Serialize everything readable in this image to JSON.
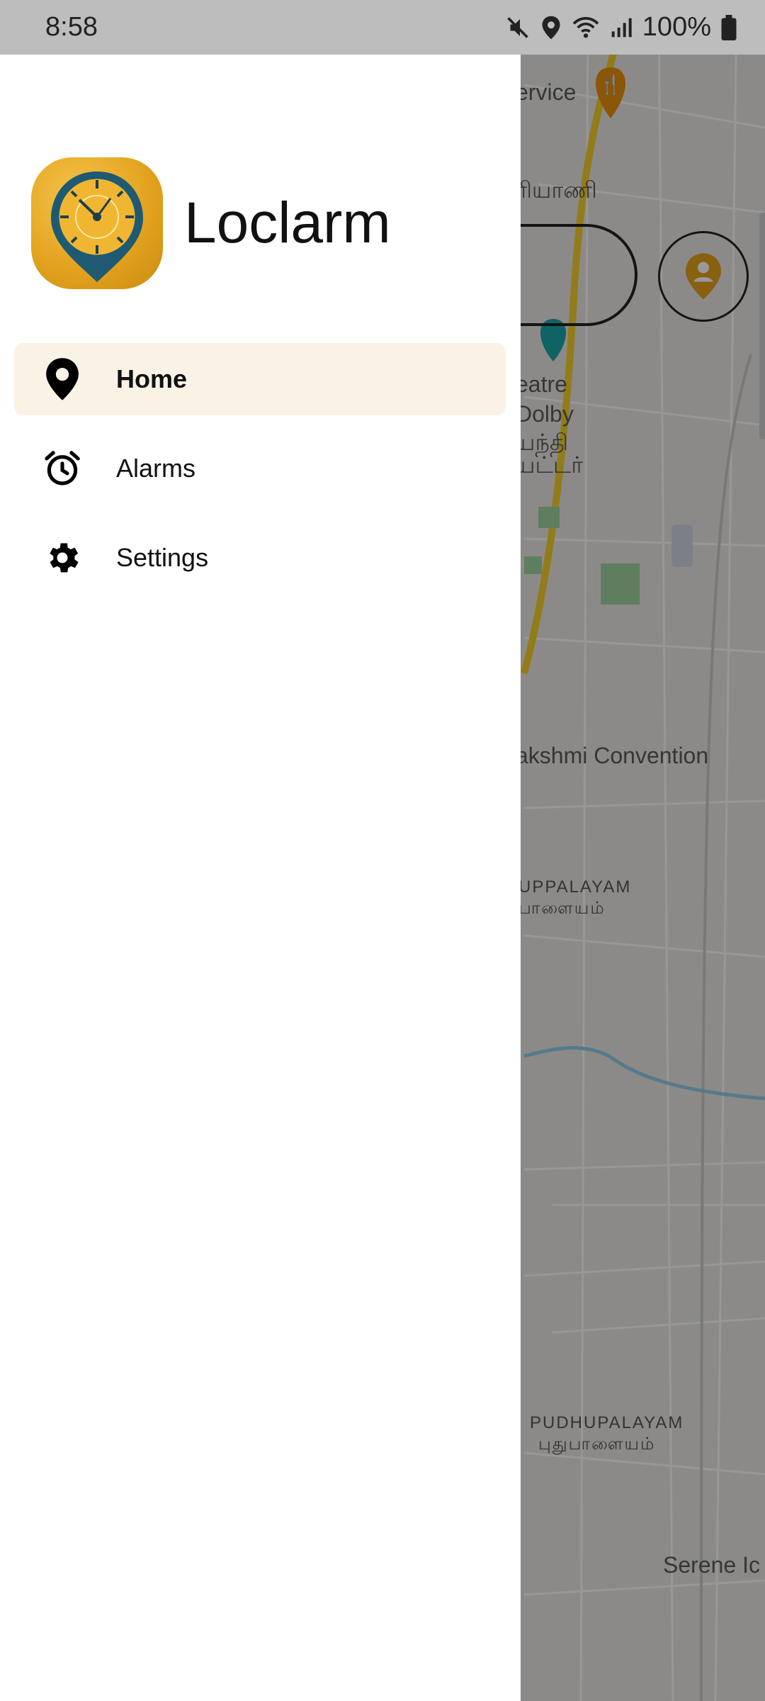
{
  "status_bar": {
    "time": "8:58",
    "battery": "100%",
    "icons": [
      "mute-icon",
      "location-icon",
      "wifi-icon",
      "signal-icon",
      "battery-icon"
    ]
  },
  "drawer": {
    "app_title": "Loclarm",
    "logo_icon": "clock-pin-logo",
    "items": [
      {
        "label": "Home",
        "icon": "location-pin-icon",
        "active": true
      },
      {
        "label": "Alarms",
        "icon": "alarm-clock-icon",
        "active": false
      },
      {
        "label": "Settings",
        "icon": "gear-icon",
        "active": false
      }
    ]
  },
  "map": {
    "labels": [
      "ervice",
      "ரியாணி",
      "eatre",
      "Dolby",
      "யந்தி",
      "யட்டர்",
      "akshmi Convention",
      "UPPALAYAM",
      "பாளையம்",
      "PUDHUPALAYAM",
      "புதுபாளையம்",
      "Serene Ic"
    ]
  },
  "colors": {
    "accent": "#e2a11c",
    "active_item_bg": "#fbf2e6",
    "drawer_bg": "#ffffff",
    "status_bar_bg": "#bdbdbd"
  }
}
